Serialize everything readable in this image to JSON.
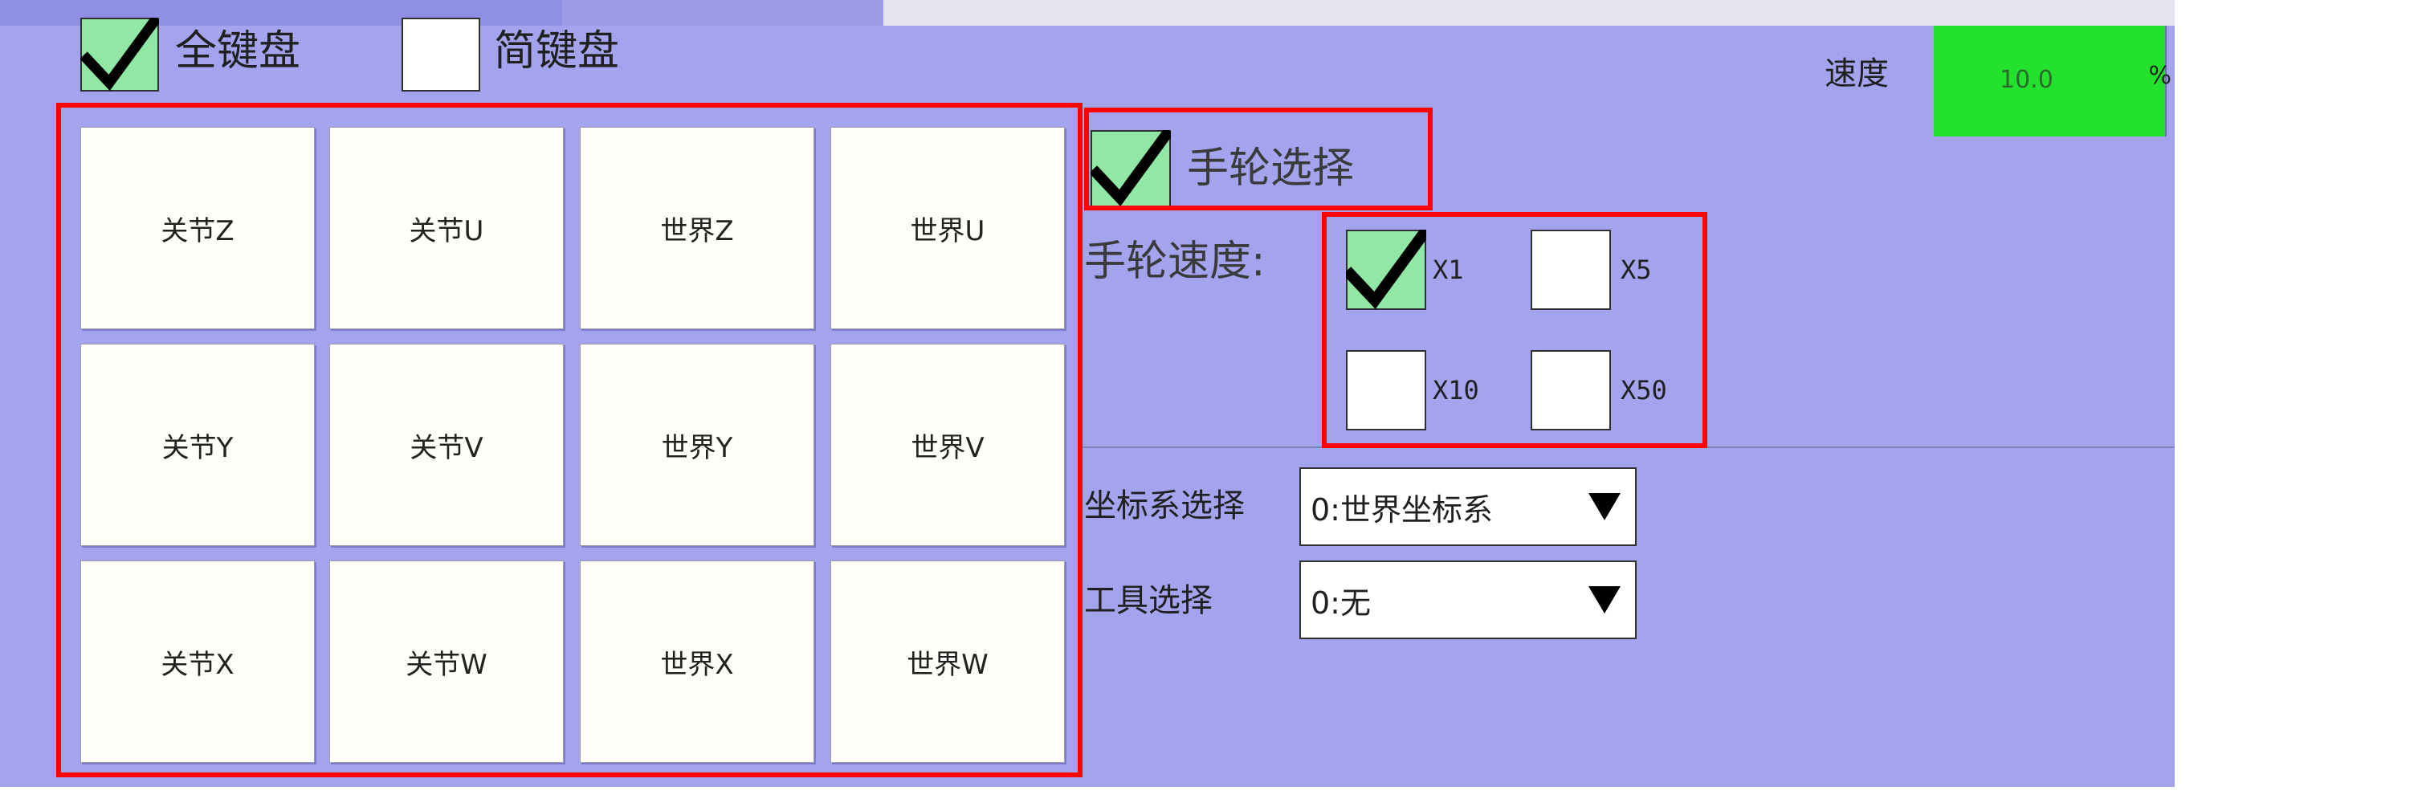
{
  "keyboard_mode": {
    "full_label": "全键盘",
    "full_checked": true,
    "simple_label": "简键盘",
    "simple_checked": false
  },
  "jog_keys": [
    [
      "关节Z",
      "关节U",
      "世界Z",
      "世界U"
    ],
    [
      "关节Y",
      "关节V",
      "世界Y",
      "世界V"
    ],
    [
      "关节X",
      "关节W",
      "世界X",
      "世界W"
    ]
  ],
  "speed": {
    "label": "速度",
    "value": "10.0",
    "unit": "%"
  },
  "handwheel": {
    "select_label": "手轮选择",
    "select_checked": true,
    "speed_label": "手轮速度:",
    "options": [
      {
        "label": "X1",
        "checked": true
      },
      {
        "label": "X5",
        "checked": false
      },
      {
        "label": "X10",
        "checked": false
      },
      {
        "label": "X50",
        "checked": false
      }
    ]
  },
  "coordinate": {
    "label": "坐标系选择",
    "value": "0:世界坐标系"
  },
  "tool": {
    "label": "工具选择",
    "value": "0:无"
  },
  "colors": {
    "panel_bg": "#a4a4ee",
    "speed_bg": "#22e22e",
    "highlight": "#ff0000",
    "check_on": "#90e8a4"
  },
  "icons": {
    "check": "check-icon",
    "dropdown": "triangle-down-icon"
  }
}
